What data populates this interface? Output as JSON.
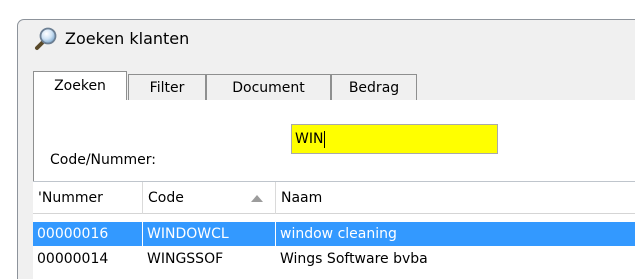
{
  "window": {
    "title": "Zoeken klanten",
    "icon": "search-icon"
  },
  "tabs": [
    {
      "label": "Zoeken",
      "active": true
    },
    {
      "label": "Filter",
      "active": false
    },
    {
      "label": "Document",
      "active": false
    },
    {
      "label": "Bedrag",
      "active": false
    }
  ],
  "search": {
    "label": "Code/Nummer:",
    "value": "WIN",
    "input_color": "#ffff00"
  },
  "grid": {
    "columns": [
      "'Nummer",
      "Code",
      "Naam"
    ],
    "sorted_column": "Code",
    "sort_direction": "ascending",
    "rows": [
      {
        "nummer": "00000016",
        "code": "WINDOWCL",
        "naam": "window cleaning",
        "selected": true
      },
      {
        "nummer": "00000014",
        "code": "WINGSSOF",
        "naam": "Wings Software bvba",
        "selected": false
      }
    ],
    "selection_color": "#3399ff"
  }
}
